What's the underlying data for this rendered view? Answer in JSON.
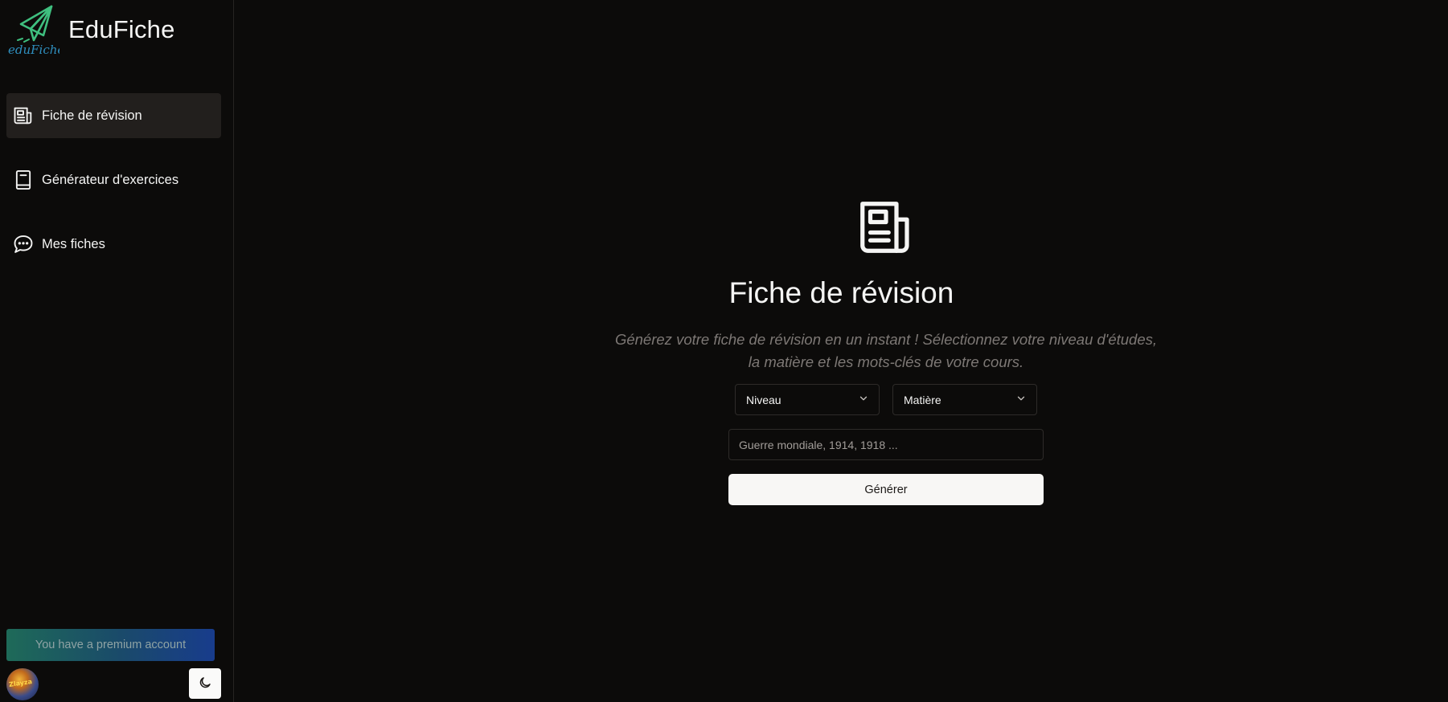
{
  "brand": {
    "title": "EduFiche",
    "logo_text": "eduFiche"
  },
  "sidebar": {
    "items": [
      {
        "label": "Fiche de révision",
        "icon": "newspaper-icon",
        "active": true
      },
      {
        "label": "Générateur d'exercices",
        "icon": "book-icon",
        "active": false
      },
      {
        "label": "Mes fiches",
        "icon": "message-dots-icon",
        "active": false
      }
    ],
    "premium_label": "You have a premium account",
    "avatar_text": "Zlayza"
  },
  "main": {
    "icon": "newspaper-icon",
    "title": "Fiche de révision",
    "subtitle": "Générez votre fiche de révision en un instant ! Sélectionnez votre niveau d'études, la matière et les mots-clés de votre cours.",
    "level_select": "Niveau",
    "subject_select": "Matière",
    "keywords_placeholder": "Guerre mondiale, 1914, 1918 ...",
    "generate_label": "Générer"
  },
  "colors": {
    "background": "#0c0b0a",
    "logo_green": "#3fbf7f",
    "logo_blue": "#2f8fbf",
    "premium_gradient_start": "#1e6a58",
    "premium_gradient_end": "#183c8c"
  }
}
